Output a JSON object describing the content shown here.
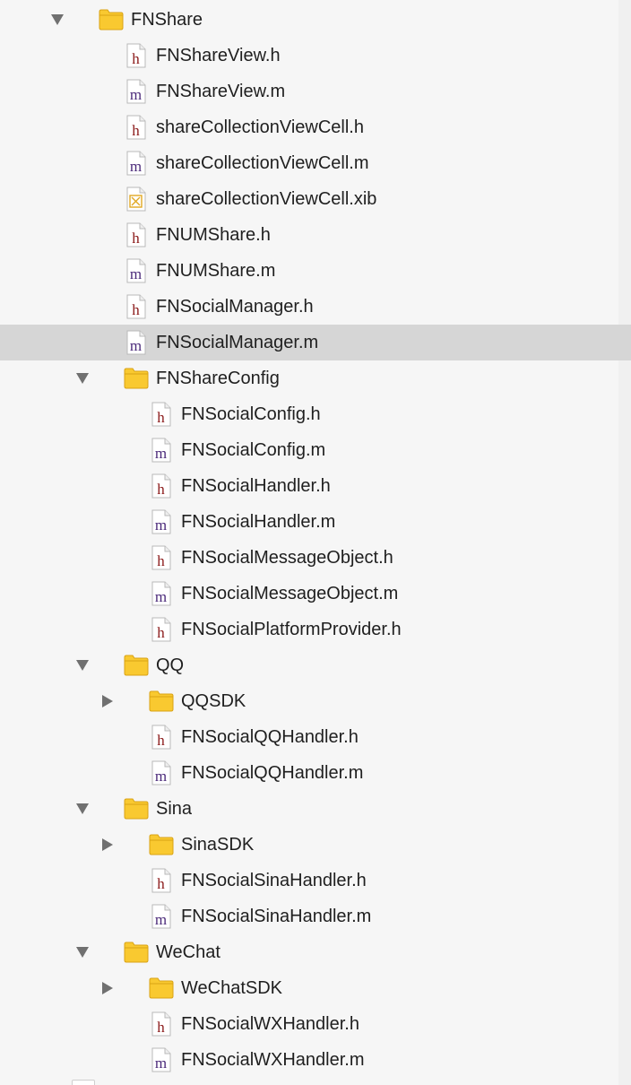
{
  "navigator": {
    "selected_index": 9,
    "rows": [
      {
        "label": "FNShare",
        "kind": "folder",
        "depth": 0,
        "state": "expanded"
      },
      {
        "label": "FNShareView.h",
        "kind": "h",
        "depth": 1
      },
      {
        "label": "FNShareView.m",
        "kind": "m",
        "depth": 1
      },
      {
        "label": "shareCollectionViewCell.h",
        "kind": "h",
        "depth": 1
      },
      {
        "label": "shareCollectionViewCell.m",
        "kind": "m",
        "depth": 1
      },
      {
        "label": "shareCollectionViewCell.xib",
        "kind": "xib",
        "depth": 1
      },
      {
        "label": "FNUMShare.h",
        "kind": "h",
        "depth": 1
      },
      {
        "label": "FNUMShare.m",
        "kind": "m",
        "depth": 1
      },
      {
        "label": "FNSocialManager.h",
        "kind": "h",
        "depth": 1
      },
      {
        "label": "FNSocialManager.m",
        "kind": "m",
        "depth": 1
      },
      {
        "label": "FNShareConfig",
        "kind": "folder",
        "depth": 1,
        "state": "expanded"
      },
      {
        "label": "FNSocialConfig.h",
        "kind": "h",
        "depth": 2
      },
      {
        "label": "FNSocialConfig.m",
        "kind": "m",
        "depth": 2
      },
      {
        "label": "FNSocialHandler.h",
        "kind": "h",
        "depth": 2
      },
      {
        "label": "FNSocialHandler.m",
        "kind": "m",
        "depth": 2
      },
      {
        "label": "FNSocialMessageObject.h",
        "kind": "h",
        "depth": 2
      },
      {
        "label": "FNSocialMessageObject.m",
        "kind": "m",
        "depth": 2
      },
      {
        "label": "FNSocialPlatformProvider.h",
        "kind": "h",
        "depth": 2
      },
      {
        "label": "QQ",
        "kind": "folder",
        "depth": 1,
        "state": "expanded"
      },
      {
        "label": "QQSDK",
        "kind": "folder",
        "depth": 2,
        "state": "collapsed"
      },
      {
        "label": "FNSocialQQHandler.h",
        "kind": "h",
        "depth": 2
      },
      {
        "label": "FNSocialQQHandler.m",
        "kind": "m",
        "depth": 2
      },
      {
        "label": "Sina",
        "kind": "folder",
        "depth": 1,
        "state": "expanded"
      },
      {
        "label": "SinaSDK",
        "kind": "folder",
        "depth": 2,
        "state": "collapsed"
      },
      {
        "label": "FNSocialSinaHandler.h",
        "kind": "h",
        "depth": 2
      },
      {
        "label": "FNSocialSinaHandler.m",
        "kind": "m",
        "depth": 2
      },
      {
        "label": "WeChat",
        "kind": "folder",
        "depth": 1,
        "state": "expanded"
      },
      {
        "label": "WeChatSDK",
        "kind": "folder",
        "depth": 2,
        "state": "collapsed"
      },
      {
        "label": "FNSocialWXHandler.h",
        "kind": "h",
        "depth": 2
      },
      {
        "label": "FNSocialWXHandler.m",
        "kind": "m",
        "depth": 2
      }
    ]
  },
  "icons": {
    "folder": "folder-icon",
    "h": "header-file-icon",
    "m": "objc-source-file-icon",
    "xib": "xib-file-icon",
    "expanded": "disclosure-expanded-icon",
    "collapsed": "disclosure-collapsed-icon"
  },
  "colors": {
    "sidebar_background": "#f6f6f6",
    "selection_background": "#d6d6d6",
    "label_text": "#1f1f1f",
    "folder_fill": "#f9c930",
    "folder_stroke": "#d9a214",
    "header_letter": "#8b1a1a",
    "source_letter": "#4b2a7a",
    "xib_mark": "#e0a823",
    "disclosure": "#707070"
  }
}
